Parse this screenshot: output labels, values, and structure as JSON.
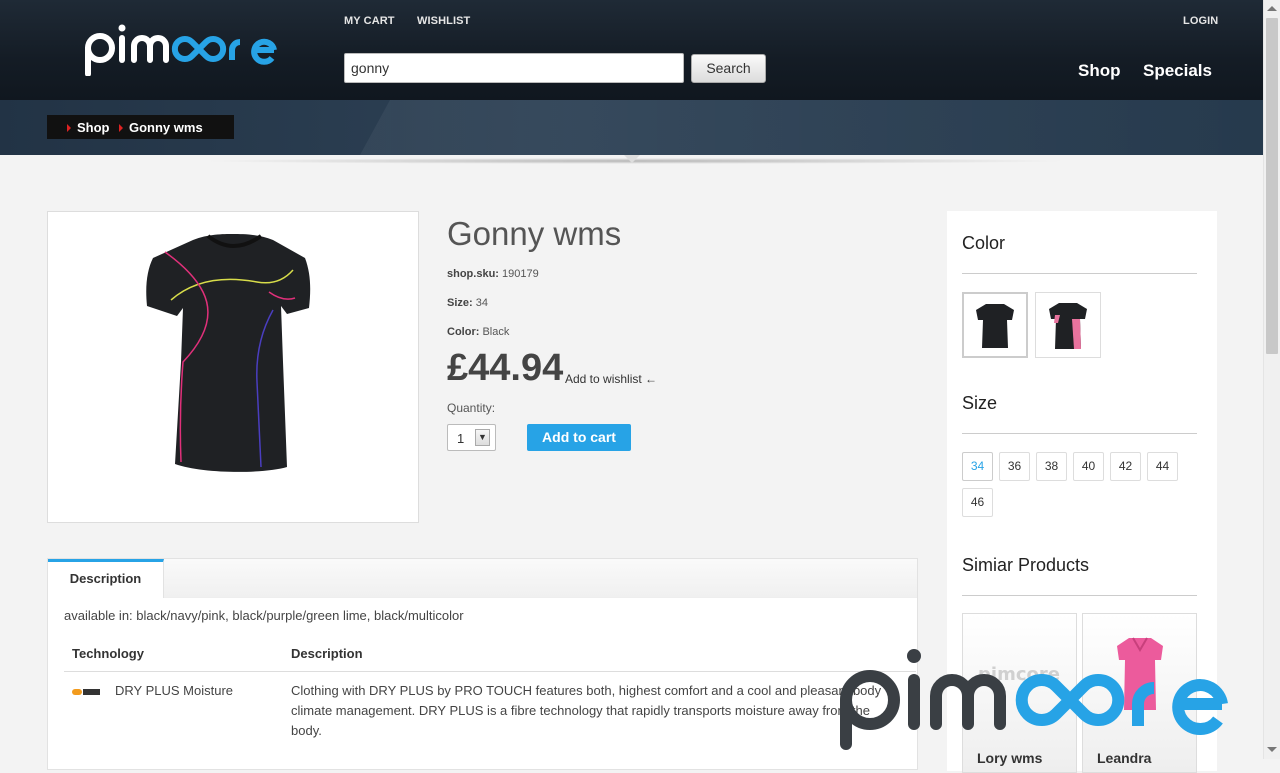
{
  "brand": {
    "name": "pimcore",
    "colors": {
      "dark": "#ffffff",
      "accent": "#27a3e6"
    }
  },
  "header": {
    "my_cart": "MY CART",
    "wishlist": "WISHLIST",
    "login": "LOGIN",
    "search": {
      "value": "gonny",
      "button": "Search"
    },
    "nav": [
      "Shop",
      "Specials"
    ]
  },
  "breadcrumb": [
    "Shop",
    "Gonny wms"
  ],
  "product": {
    "title": "Gonny wms",
    "sku_label": "shop.sku:",
    "sku": "190179",
    "size_label": "Size:",
    "size": "34",
    "color_label": "Color:",
    "color": "Black",
    "price": "£44.94",
    "add_to_wishlist": "Add to wishlist ←",
    "quantity_label": "Quantity:",
    "quantity": "1",
    "add_to_cart": "Add to cart"
  },
  "tabs": {
    "active": "Description",
    "available": "available in: black/navy/pink, black/purple/green lime, black/multicolor",
    "columns": [
      "Technology",
      "Description"
    ],
    "rows": [
      {
        "technology": "DRY PLUS Moisture",
        "description": "Clothing with DRY PLUS by PRO TOUCH features both, highest comfort and a cool and pleasant body climate management. DRY PLUS is a fibre technology that rapidly transports moisture away from the body."
      }
    ]
  },
  "sidebar": {
    "color_title": "Color",
    "size_title": "Size",
    "sizes": [
      "34",
      "36",
      "38",
      "40",
      "42",
      "44",
      "46"
    ],
    "selected_size": "34",
    "similar_title": "Simiar Products",
    "similar": [
      "Lory wms",
      "Leandra"
    ]
  }
}
